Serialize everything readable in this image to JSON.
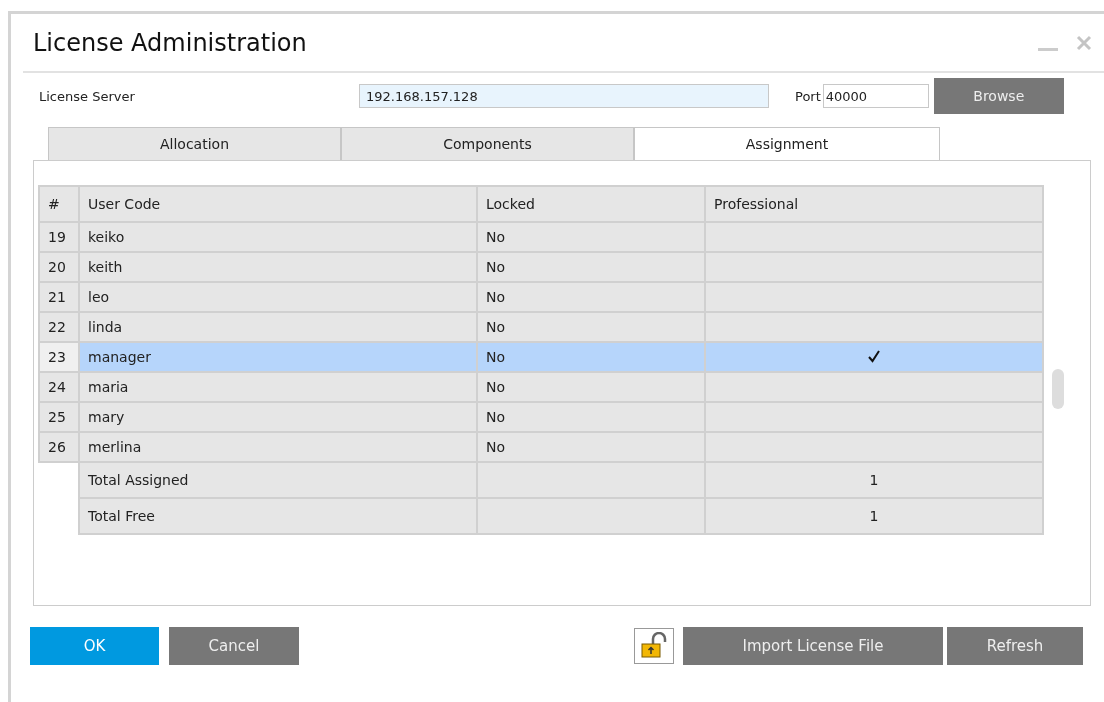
{
  "window": {
    "title": "License Administration"
  },
  "server": {
    "label": "License Server",
    "value": "192.168.157.128",
    "port_label": "Port",
    "port_value": "40000",
    "browse": "Browse"
  },
  "tabs": [
    {
      "label": "Allocation",
      "selected": false
    },
    {
      "label": "Components",
      "selected": false
    },
    {
      "label": "Assignment",
      "selected": true
    }
  ],
  "table": {
    "columns": [
      "#",
      "User Code",
      "Locked",
      "Professional"
    ],
    "rows": [
      {
        "num": "19",
        "user": "keiko",
        "locked": "No",
        "professional": false,
        "selected": false
      },
      {
        "num": "20",
        "user": "keith",
        "locked": "No",
        "professional": false,
        "selected": false
      },
      {
        "num": "21",
        "user": "leo",
        "locked": "No",
        "professional": false,
        "selected": false
      },
      {
        "num": "22",
        "user": "linda",
        "locked": "No",
        "professional": false,
        "selected": false
      },
      {
        "num": "23",
        "user": "manager",
        "locked": "No",
        "professional": true,
        "selected": true
      },
      {
        "num": "24",
        "user": "maria",
        "locked": "No",
        "professional": false,
        "selected": false
      },
      {
        "num": "25",
        "user": "mary",
        "locked": "No",
        "professional": false,
        "selected": false
      },
      {
        "num": "26",
        "user": "merlina",
        "locked": "No",
        "professional": false,
        "selected": false
      }
    ],
    "totals": [
      {
        "label": "Total Assigned",
        "professional": "1"
      },
      {
        "label": "Total Free",
        "professional": "1"
      }
    ]
  },
  "buttons": {
    "ok": "OK",
    "cancel": "Cancel",
    "import": "Import License File",
    "refresh": "Refresh"
  }
}
